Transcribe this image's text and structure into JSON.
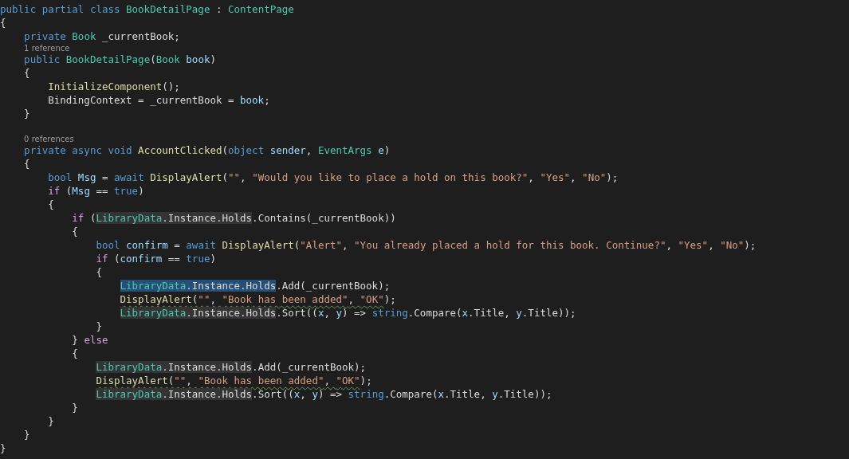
{
  "editor": {
    "lines": [
      {
        "kind": "code",
        "tokens": [
          {
            "kind": "kw",
            "text": "public partial class "
          },
          {
            "kind": "type",
            "text": "BookDetailPage"
          },
          {
            "kind": "plain",
            "text": " : "
          },
          {
            "kind": "type",
            "text": "ContentPage"
          }
        ]
      },
      {
        "kind": "code",
        "tokens": [
          {
            "kind": "plain",
            "text": "{"
          }
        ]
      },
      {
        "kind": "code",
        "tokens": [
          {
            "kind": "kw",
            "text": "    private "
          },
          {
            "kind": "type",
            "text": "Book"
          },
          {
            "kind": "plain",
            "text": " _currentBook;"
          }
        ]
      },
      {
        "kind": "lens",
        "text": "    1 reference"
      },
      {
        "kind": "code",
        "tokens": [
          {
            "kind": "kw",
            "text": "    public "
          },
          {
            "kind": "type",
            "text": "BookDetailPage"
          },
          {
            "kind": "plain",
            "text": "("
          },
          {
            "kind": "type",
            "text": "Book"
          },
          {
            "kind": "var",
            "text": " book"
          },
          {
            "kind": "plain",
            "text": ")"
          }
        ]
      },
      {
        "kind": "code",
        "tokens": [
          {
            "kind": "plain",
            "text": "    {"
          }
        ]
      },
      {
        "kind": "code",
        "tokens": [
          {
            "kind": "fn",
            "text": "        InitializeComponent"
          },
          {
            "kind": "plain",
            "text": "();"
          }
        ]
      },
      {
        "kind": "code",
        "tokens": [
          {
            "kind": "plain",
            "text": "        BindingContext = _currentBook = "
          },
          {
            "kind": "var",
            "text": "book"
          },
          {
            "kind": "plain",
            "text": ";"
          }
        ]
      },
      {
        "kind": "code",
        "tokens": [
          {
            "kind": "plain",
            "text": "    }"
          }
        ]
      },
      {
        "kind": "blank"
      },
      {
        "kind": "lens",
        "text": "    0 references"
      },
      {
        "kind": "code",
        "tokens": [
          {
            "kind": "kw",
            "text": "    private async void "
          },
          {
            "kind": "fn",
            "text": "AccountClicked"
          },
          {
            "kind": "plain",
            "text": "("
          },
          {
            "kind": "kw",
            "text": "object "
          },
          {
            "kind": "var",
            "text": "sender"
          },
          {
            "kind": "plain",
            "text": ", "
          },
          {
            "kind": "type",
            "text": "EventArgs "
          },
          {
            "kind": "var",
            "text": "e"
          },
          {
            "kind": "plain",
            "text": ")"
          }
        ]
      },
      {
        "kind": "code",
        "tokens": [
          {
            "kind": "plain",
            "text": "    {"
          }
        ]
      },
      {
        "kind": "code",
        "tokens": [
          {
            "kind": "kw",
            "text": "        bool "
          },
          {
            "kind": "var",
            "text": "Msg"
          },
          {
            "kind": "plain",
            "text": " = "
          },
          {
            "kind": "kw",
            "text": "await "
          },
          {
            "kind": "fn",
            "text": "DisplayAlert"
          },
          {
            "kind": "plain",
            "text": "("
          },
          {
            "kind": "str",
            "text": "\"\""
          },
          {
            "kind": "plain",
            "text": ", "
          },
          {
            "kind": "str",
            "text": "\"Would you like to place a hold on this book?\""
          },
          {
            "kind": "plain",
            "text": ", "
          },
          {
            "kind": "str",
            "text": "\"Yes\""
          },
          {
            "kind": "plain",
            "text": ", "
          },
          {
            "kind": "str",
            "text": "\"No\""
          },
          {
            "kind": "plain",
            "text": ");"
          }
        ]
      },
      {
        "kind": "code",
        "tokens": [
          {
            "kind": "ctl",
            "text": "        if "
          },
          {
            "kind": "plain",
            "text": "("
          },
          {
            "kind": "var",
            "text": "Msg"
          },
          {
            "kind": "plain",
            "text": " == "
          },
          {
            "kind": "kw",
            "text": "true"
          },
          {
            "kind": "plain",
            "text": ")"
          }
        ]
      },
      {
        "kind": "code",
        "tokens": [
          {
            "kind": "plain",
            "text": "        {"
          }
        ]
      },
      {
        "kind": "code",
        "tokens": [
          {
            "kind": "ctl",
            "text": "            if "
          },
          {
            "kind": "plain",
            "text": "("
          },
          {
            "kind": "type",
            "text": "LibraryData",
            "highlighted": true
          },
          {
            "kind": "plain",
            "text": ".Instance.Holds",
            "highlighted": true
          },
          {
            "kind": "plain",
            "text": ".Contains(_currentBook))"
          }
        ]
      },
      {
        "kind": "code",
        "tokens": [
          {
            "kind": "plain",
            "text": "            {"
          }
        ]
      },
      {
        "kind": "code",
        "tokens": [
          {
            "kind": "kw",
            "text": "                bool "
          },
          {
            "kind": "var",
            "text": "confirm"
          },
          {
            "kind": "plain",
            "text": " = "
          },
          {
            "kind": "kw",
            "text": "await "
          },
          {
            "kind": "fn",
            "text": "DisplayAlert"
          },
          {
            "kind": "plain",
            "text": "("
          },
          {
            "kind": "str",
            "text": "\"Alert\""
          },
          {
            "kind": "plain",
            "text": ", "
          },
          {
            "kind": "str",
            "text": "\"You already placed a hold for this book. Continue?\""
          },
          {
            "kind": "plain",
            "text": ", "
          },
          {
            "kind": "str",
            "text": "\"Yes\""
          },
          {
            "kind": "plain",
            "text": ", "
          },
          {
            "kind": "str",
            "text": "\"No\""
          },
          {
            "kind": "plain",
            "text": ");"
          }
        ]
      },
      {
        "kind": "code",
        "tokens": [
          {
            "kind": "ctl",
            "text": "                if "
          },
          {
            "kind": "plain",
            "text": "("
          },
          {
            "kind": "var",
            "text": "confirm"
          },
          {
            "kind": "plain",
            "text": " == "
          },
          {
            "kind": "kw",
            "text": "true"
          },
          {
            "kind": "plain",
            "text": ")"
          }
        ]
      },
      {
        "kind": "code",
        "tokens": [
          {
            "kind": "plain",
            "text": "                {"
          }
        ]
      },
      {
        "kind": "code",
        "tokens": [
          {
            "kind": "type",
            "text": "                    LibraryData",
            "selected": true
          },
          {
            "kind": "plain",
            "text": ".Instance.Holds",
            "selected": true
          },
          {
            "kind": "plain",
            "text": ".Add(_currentBook);"
          }
        ]
      },
      {
        "kind": "code",
        "tokens": [
          {
            "kind": "fn",
            "text": "                    DisplayAlert",
            "squiggle": true
          },
          {
            "kind": "plain",
            "text": "(",
            "squiggle": true
          },
          {
            "kind": "str",
            "text": "\"\"",
            "squiggle": true
          },
          {
            "kind": "plain",
            "text": ", ",
            "squiggle": true
          },
          {
            "kind": "str",
            "text": "\"Book has been added\"",
            "squiggle": true
          },
          {
            "kind": "plain",
            "text": ", ",
            "squiggle": true
          },
          {
            "kind": "str",
            "text": "\"OK\"",
            "squiggle": true
          },
          {
            "kind": "plain",
            "text": ");"
          }
        ]
      },
      {
        "kind": "code",
        "tokens": [
          {
            "kind": "type",
            "text": "                    LibraryData",
            "highlighted": true
          },
          {
            "kind": "plain",
            "text": ".Instance.Holds",
            "highlighted": true
          },
          {
            "kind": "plain",
            "text": ".Sort(("
          },
          {
            "kind": "var",
            "text": "x"
          },
          {
            "kind": "plain",
            "text": ", "
          },
          {
            "kind": "var",
            "text": "y"
          },
          {
            "kind": "plain",
            "text": ") => "
          },
          {
            "kind": "kw",
            "text": "string"
          },
          {
            "kind": "plain",
            "text": ".Compare("
          },
          {
            "kind": "var",
            "text": "x"
          },
          {
            "kind": "plain",
            "text": ".Title, "
          },
          {
            "kind": "var",
            "text": "y"
          },
          {
            "kind": "plain",
            "text": ".Title));"
          }
        ]
      },
      {
        "kind": "code",
        "tokens": [
          {
            "kind": "plain",
            "text": "                }"
          }
        ]
      },
      {
        "kind": "code",
        "tokens": [
          {
            "kind": "plain",
            "text": "            } "
          },
          {
            "kind": "ctl",
            "text": "else"
          }
        ]
      },
      {
        "kind": "code",
        "tokens": [
          {
            "kind": "plain",
            "text": "            {"
          }
        ]
      },
      {
        "kind": "code",
        "tokens": [
          {
            "kind": "type",
            "text": "                LibraryData",
            "highlighted": true
          },
          {
            "kind": "plain",
            "text": ".Instance.Holds",
            "highlighted": true
          },
          {
            "kind": "plain",
            "text": ".Add(_currentBook);"
          }
        ]
      },
      {
        "kind": "code",
        "tokens": [
          {
            "kind": "fn",
            "text": "                DisplayAlert",
            "squiggle": true
          },
          {
            "kind": "plain",
            "text": "(",
            "squiggle": true
          },
          {
            "kind": "str",
            "text": "\"\"",
            "squiggle": true
          },
          {
            "kind": "plain",
            "text": ", ",
            "squiggle": true
          },
          {
            "kind": "str",
            "text": "\"Book has been added\"",
            "squiggle": true
          },
          {
            "kind": "plain",
            "text": ", ",
            "squiggle": true
          },
          {
            "kind": "str",
            "text": "\"OK\"",
            "squiggle": true
          },
          {
            "kind": "plain",
            "text": ");"
          }
        ]
      },
      {
        "kind": "code",
        "tokens": [
          {
            "kind": "type",
            "text": "                LibraryData",
            "highlighted": true
          },
          {
            "kind": "plain",
            "text": ".Instance.Holds",
            "highlighted": true
          },
          {
            "kind": "plain",
            "text": ".Sort(("
          },
          {
            "kind": "var",
            "text": "x"
          },
          {
            "kind": "plain",
            "text": ", "
          },
          {
            "kind": "var",
            "text": "y"
          },
          {
            "kind": "plain",
            "text": ") => "
          },
          {
            "kind": "kw",
            "text": "string"
          },
          {
            "kind": "plain",
            "text": ".Compare("
          },
          {
            "kind": "var",
            "text": "x"
          },
          {
            "kind": "plain",
            "text": ".Title, "
          },
          {
            "kind": "var",
            "text": "y"
          },
          {
            "kind": "plain",
            "text": ".Title));"
          }
        ]
      },
      {
        "kind": "code",
        "tokens": [
          {
            "kind": "plain",
            "text": "            }"
          }
        ]
      },
      {
        "kind": "code",
        "tokens": [
          {
            "kind": "plain",
            "text": "        }"
          }
        ]
      },
      {
        "kind": "code",
        "tokens": [
          {
            "kind": "plain",
            "text": "    }"
          }
        ]
      },
      {
        "kind": "code",
        "tokens": [
          {
            "kind": "plain",
            "text": "}"
          }
        ]
      }
    ]
  }
}
